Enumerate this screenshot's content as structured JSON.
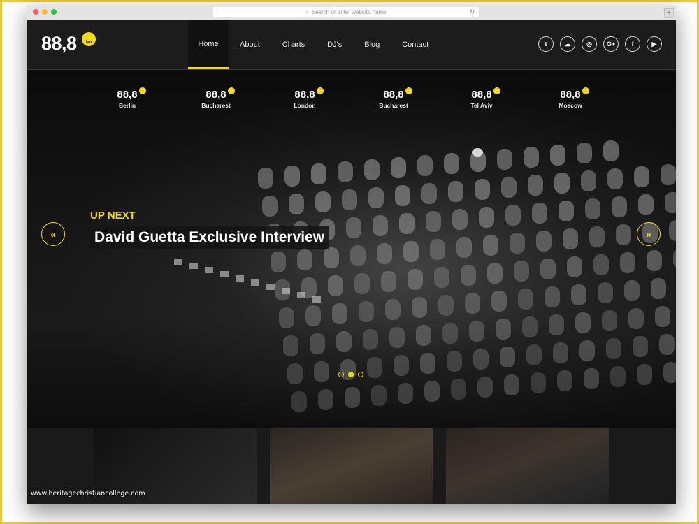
{
  "browser": {
    "url_placeholder": "Search or enter website name",
    "newtab_label": "+"
  },
  "header": {
    "logo_text": "88,8",
    "logo_badge": "fm",
    "nav": [
      {
        "label": "Home",
        "active": true
      },
      {
        "label": "About"
      },
      {
        "label": "Charts"
      },
      {
        "label": "DJ's"
      },
      {
        "label": "Blog"
      },
      {
        "label": "Contact"
      }
    ],
    "socials": [
      {
        "name": "twitter-icon",
        "glyph": "t"
      },
      {
        "name": "soundcloud-icon",
        "glyph": "☁"
      },
      {
        "name": "instagram-icon",
        "glyph": "◎"
      },
      {
        "name": "google-plus-icon",
        "glyph": "G+"
      },
      {
        "name": "facebook-icon",
        "glyph": "f"
      },
      {
        "name": "youtube-icon",
        "glyph": "▶"
      }
    ]
  },
  "stations": [
    {
      "logo": "88,8",
      "city": "Berlin"
    },
    {
      "logo": "88,8",
      "city": "Bucharest"
    },
    {
      "logo": "88,8",
      "city": "London"
    },
    {
      "logo": "88,8",
      "city": "Bucharest"
    },
    {
      "logo": "88,8",
      "city": "Tel Aviv"
    },
    {
      "logo": "88,8",
      "city": "Moscow"
    }
  ],
  "hero": {
    "eyebrow": "UP NEXT",
    "headline": "David Guetta Exclusive Interview",
    "prev_glyph": "«",
    "next_glyph": "»",
    "slide_count": 3,
    "active_slide": 2
  },
  "watermark": "www.heritagechristiancollege.com",
  "colors": {
    "accent": "#f4d919",
    "header_bg": "#1c1c1c"
  }
}
